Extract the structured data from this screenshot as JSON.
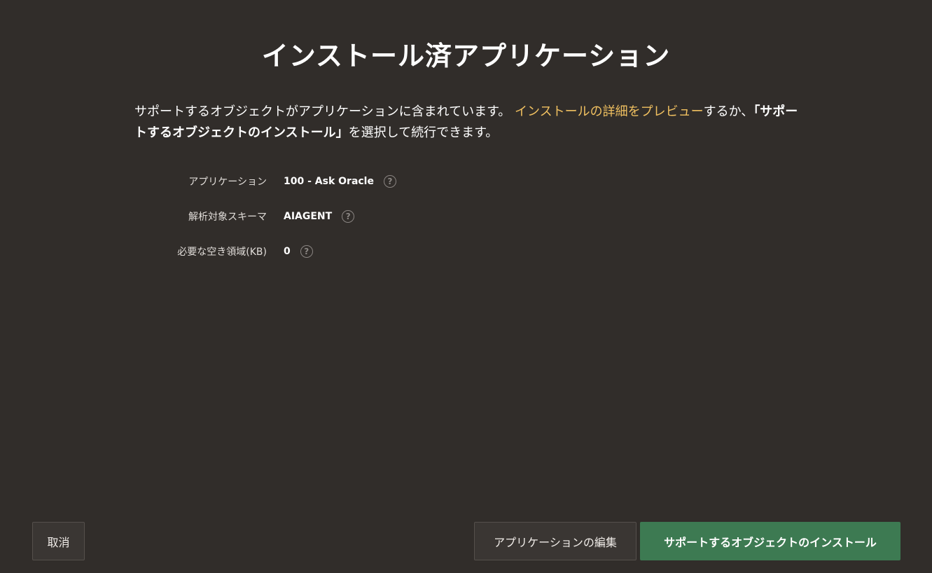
{
  "page": {
    "title": "インストール済アプリケーション"
  },
  "description": {
    "text_before_link": "サポートするオブジェクトがアプリケーションに含まれています。 ",
    "link": "インストールの詳細をプレビュー",
    "text_after_link": "するか、",
    "strong": "「サポートするオブジェクトのインストール」",
    "text_end": "を選択して続行できます。"
  },
  "details": [
    {
      "label": "アプリケーション",
      "value": "100 - Ask Oracle",
      "help_icon": "question-circle-icon"
    },
    {
      "label": "解析対象スキーマ",
      "value": "AIAGENT",
      "help_icon": "question-circle-icon"
    },
    {
      "label": "必要な空き領域(KB)",
      "value": "0",
      "help_icon": "question-circle-icon"
    }
  ],
  "help_glyph": "?",
  "buttons": {
    "cancel": "取消",
    "edit": "アプリケーションの編集",
    "install": "サポートするオブジェクトのインストール"
  },
  "colors": {
    "background": "#312d2a",
    "link": "#f0c060",
    "primary_button": "#3d7a52"
  }
}
